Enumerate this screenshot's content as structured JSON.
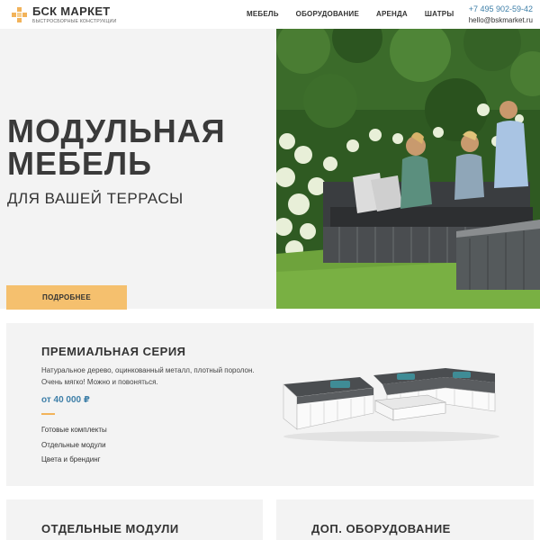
{
  "brand": {
    "name": "БСК МАРКЕТ",
    "tagline": "БЫСТРОСБОРНЫЕ КОНСТРУКЦИИ"
  },
  "nav": {
    "items": [
      {
        "label": "МЕБЕЛЬ"
      },
      {
        "label": "ОБОРУДОВАНИЕ"
      },
      {
        "label": "АРЕНДА"
      },
      {
        "label": "ШАТРЫ"
      }
    ]
  },
  "contacts": {
    "phone": "+7 495 902-59-42",
    "email": "hello@bskmarket.ru"
  },
  "hero": {
    "title_line1": "МОДУЛЬНАЯ",
    "title_line2": "МЕБЕЛЬ",
    "subtitle": "ДЛЯ ВАШЕЙ ТЕРРАСЫ",
    "button_label": "ПОДРОБНЕЕ"
  },
  "premium": {
    "title": "ПРЕМИАЛЬНАЯ СЕРИЯ",
    "desc_line1": "Натуральное дерево, оцинкованный металл, плотный поролон.",
    "desc_line2": "Очень мягко! Можно и повоняться.",
    "price": "от 40 000 ₽",
    "links": [
      {
        "label": "Готовые комплекты"
      },
      {
        "label": "Отдельные модули"
      },
      {
        "label": "Цвета и брендинг"
      }
    ]
  },
  "cards": {
    "left_title": "ОТДЕЛЬНЫЕ МОДУЛИ",
    "right_title": "ДОП. ОБОРУДОВАНИЕ"
  },
  "colors": {
    "accent": "#f5c06e",
    "link_blue": "#3e7fa8",
    "panel_bg": "#f3f3f3"
  }
}
